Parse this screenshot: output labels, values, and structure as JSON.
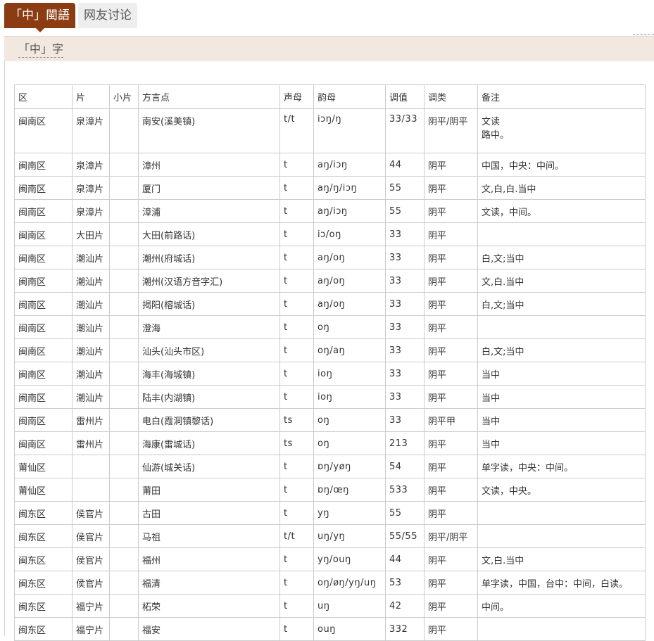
{
  "tabs": [
    {
      "label": "「中」閩語"
    },
    {
      "label": "网友讨论"
    }
  ],
  "section": {
    "title": "「中」字"
  },
  "table": {
    "headers": [
      "区",
      "片",
      "小片",
      "方言点",
      "声母",
      "韵母",
      "调值",
      "调类",
      "备注"
    ],
    "rows": [
      [
        "闽南区",
        "泉漳片",
        "",
        "南安(溪美镇)",
        "t/t",
        "iɔŋ/ŋ",
        "33/33",
        "阴平/阴平",
        "文读\n路中。"
      ],
      [
        "闽南区",
        "泉漳片",
        "",
        "漳州",
        "t",
        "aŋ/iɔŋ",
        "44",
        "阴平",
        "中国，中央：中间。"
      ],
      [
        "闽南区",
        "泉漳片",
        "",
        "厦门",
        "t",
        "aŋ/ŋ/iɔŋ",
        "55",
        "阴平",
        "文,白,白.当中"
      ],
      [
        "闽南区",
        "泉漳片",
        "",
        "漳浦",
        "t",
        "aŋ/iɔŋ",
        "55",
        "阴平",
        "文读，中间。"
      ],
      [
        "闽南区",
        "大田片",
        "",
        "大田(前路话)",
        "t",
        "iɔ/oŋ",
        "33",
        "阴平",
        ""
      ],
      [
        "闽南区",
        "潮汕片",
        "",
        "潮州(府城话)",
        "t",
        "aŋ/oŋ",
        "33",
        "阴平",
        "白,文;当中"
      ],
      [
        "闽南区",
        "潮汕片",
        "",
        "潮州(汉语方音字汇)",
        "t",
        "aŋ/oŋ",
        "33",
        "阴平",
        "文,白.当中"
      ],
      [
        "闽南区",
        "潮汕片",
        "",
        "揭阳(榕城话)",
        "t",
        "aŋ/oŋ",
        "33",
        "阴平",
        "白,文;当中"
      ],
      [
        "闽南区",
        "潮汕片",
        "",
        "澄海",
        "t",
        "oŋ",
        "33",
        "阴平",
        ""
      ],
      [
        "闽南区",
        "潮汕片",
        "",
        "汕头(汕头市区)",
        "t",
        "oŋ/aŋ",
        "33",
        "阴平",
        "白,文;当中"
      ],
      [
        "闽南区",
        "潮汕片",
        "",
        "海丰(海城镇)",
        "t",
        "ioŋ",
        "33",
        "阴平",
        "当中"
      ],
      [
        "闽南区",
        "潮汕片",
        "",
        "陆丰(内湖镇)",
        "t",
        "ioŋ",
        "33",
        "阴平",
        "当中"
      ],
      [
        "闽南区",
        "雷州片",
        "",
        "电白(霞洞镇黎话)",
        "ts",
        "oŋ",
        "33",
        "阴平甲",
        "当中"
      ],
      [
        "闽南区",
        "雷州片",
        "",
        "海康(雷城话)",
        "ts",
        "oŋ",
        "213",
        "阴平",
        "当中"
      ],
      [
        "莆仙区",
        "",
        "",
        "仙游(城关话)",
        "t",
        "ɒŋ/yøŋ",
        "54",
        "阴平",
        "单字读，中央：中间。"
      ],
      [
        "莆仙区",
        "",
        "",
        "莆田",
        "t",
        "ɒŋ/œŋ",
        "533",
        "阴平",
        "文读，中央。"
      ],
      [
        "闽东区",
        "侯官片",
        "",
        "古田",
        "t",
        "yŋ",
        "55",
        "阴平",
        ""
      ],
      [
        "闽东区",
        "侯官片",
        "",
        "马祖",
        "t/t",
        "uŋ/yŋ",
        "55/55",
        "阴平/阴平",
        ""
      ],
      [
        "闽东区",
        "侯官片",
        "",
        "福州",
        "t",
        "yŋ/ouŋ",
        "44",
        "阴平",
        "文,白.当中"
      ],
      [
        "闽东区",
        "侯官片",
        "",
        "福清",
        "t",
        "oŋ/øŋ/yŋ/uŋ",
        "53",
        "阴平",
        "单字读，中国，台中：中间，白读。"
      ],
      [
        "闽东区",
        "福宁片",
        "",
        "柘荣",
        "t",
        "uŋ",
        "42",
        "阴平",
        "中间。"
      ],
      [
        "闽东区",
        "福宁片",
        "",
        "福安",
        "t",
        "ouŋ",
        "332",
        "阴平",
        ""
      ]
    ]
  }
}
